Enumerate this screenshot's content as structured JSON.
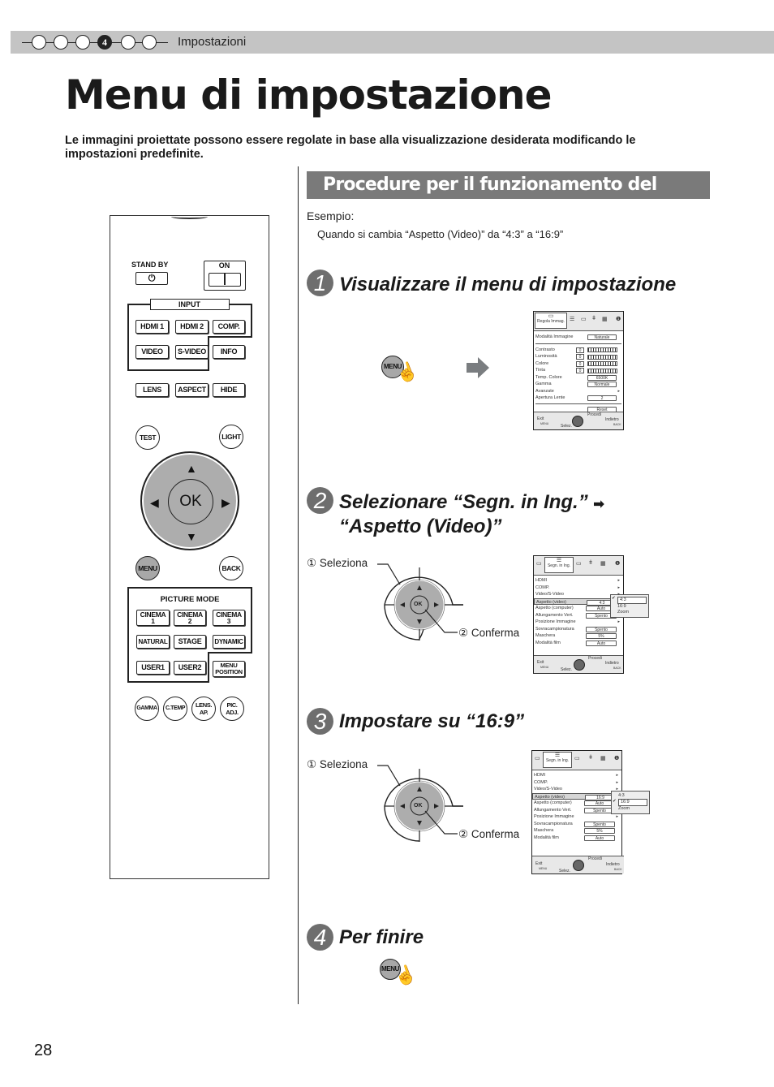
{
  "header": {
    "chapter_dots": [
      "",
      "",
      "",
      "4",
      "",
      ""
    ],
    "active_chapter": "4",
    "section": "Impostazioni"
  },
  "title": "Menu di impostazione",
  "intro": "Le immagini proiettate possono essere regolate in base alla visualizzazione desiderata modificando le impostazioni predefinite.",
  "remote": {
    "standby_label": "STAND BY",
    "on_label": "ON",
    "input_label": "INPUT",
    "input_buttons": [
      "HDMI 1",
      "HDMI 2",
      "COMP.",
      "VIDEO",
      "S-VIDEO",
      "INFO"
    ],
    "row_buttons": [
      "LENS",
      "ASPECT",
      "HIDE"
    ],
    "test": "TEST",
    "light": "LIGHT",
    "ok": "OK",
    "menu": "MENU",
    "back": "BACK",
    "picture_mode_label": "PICTURE MODE",
    "picture_mode_buttons": [
      {
        "l1": "CINEMA",
        "l2": "1"
      },
      {
        "l1": "CINEMA",
        "l2": "2"
      },
      {
        "l1": "CINEMA",
        "l2": "3"
      },
      {
        "l1": "NATURAL",
        "l2": ""
      },
      {
        "l1": "STAGE",
        "l2": ""
      },
      {
        "l1": "DYNAMIC",
        "l2": ""
      },
      {
        "l1": "USER1",
        "l2": ""
      },
      {
        "l1": "USER2",
        "l2": ""
      },
      {
        "l1": "MENU",
        "l2": "POSITION"
      }
    ],
    "bottom_buttons": [
      {
        "l1": "GAMMA",
        "l2": ""
      },
      {
        "l1": "C.TEMP",
        "l2": ""
      },
      {
        "l1": "LENS.",
        "l2": "AP."
      },
      {
        "l1": "PIC.",
        "l2": "ADJ."
      }
    ]
  },
  "main": {
    "banner": "Procedure per il funzionamento del menu",
    "example_label": "Esempio:",
    "example_text": "Quando si cambia “Aspetto (Video)” da “4:3” a “16:9”",
    "steps": [
      {
        "num": "1",
        "text": "Visualizzare il menu di impostazione"
      },
      {
        "num": "2",
        "text": "Selezionare “Segn. in Ing.”",
        "text2": "“Aspetto (Video)”"
      },
      {
        "num": "3",
        "text": "Impostare su “16:9”"
      },
      {
        "num": "4",
        "text": "Per finire"
      }
    ],
    "menu_button": "MENU",
    "dpad": {
      "select": "Seleziona",
      "confirm": "Conferma",
      "ok": "OK",
      "n1": "①",
      "n2": "②"
    }
  },
  "osd1": {
    "tab": "Regola Immag.",
    "rows": [
      {
        "label": "Modalità Immagine",
        "value": "Naturale"
      },
      {
        "label": "Contrasto",
        "num": "0"
      },
      {
        "label": "Luminosità",
        "num": "0"
      },
      {
        "label": "Colore",
        "num": "0"
      },
      {
        "label": "Tinta",
        "num": "0"
      },
      {
        "label": "Temp. Colore",
        "value": "6500K"
      },
      {
        "label": "Gamma",
        "value": "Normale"
      },
      {
        "label": "Avanzate",
        "value": ""
      },
      {
        "label": "Apertura Lente",
        "value": "2"
      },
      {
        "label": "",
        "value": "Reset"
      }
    ],
    "footer": {
      "exit": "Exit",
      "exit_key": "MENU",
      "select": "Selez.",
      "enter": "Procedi",
      "back": "Indietro",
      "back_key": "BACK"
    }
  },
  "osd2": {
    "tab": "Segn. in Ing.",
    "rows": [
      {
        "label": "HDMI",
        "value": ""
      },
      {
        "label": "COMP.",
        "value": ""
      },
      {
        "label": "Video/S-Video",
        "value": ""
      },
      {
        "label": "Aspetto (video)",
        "value": "4:3"
      },
      {
        "label": "Aspetto (computer)",
        "value": "Auto"
      },
      {
        "label": "Allungamento Vert.",
        "value": "Spento"
      },
      {
        "label": "Posizione Immagine",
        "value": ""
      },
      {
        "label": "Sovracampionatura",
        "value": "Spento"
      },
      {
        "label": "Maschera",
        "value": "5%"
      },
      {
        "label": "Modalità film",
        "value": "Auto"
      }
    ],
    "popup": [
      "4:3",
      "16:9",
      "Zoom"
    ],
    "popup_selected": "4:3",
    "footer": {
      "exit": "Exit",
      "exit_key": "MENU",
      "select": "Selez.",
      "enter": "Procedi",
      "back": "Indietro",
      "back_key": "BACK"
    }
  },
  "osd3": {
    "tab": "Segn. in Ing.",
    "rows": [
      {
        "label": "HDMI",
        "value": ""
      },
      {
        "label": "COMP.",
        "value": ""
      },
      {
        "label": "Video/S-Video",
        "value": ""
      },
      {
        "label": "Aspetto (video)",
        "value": "16:9"
      },
      {
        "label": "Aspetto (computer)",
        "value": "Auto"
      },
      {
        "label": "Allungamento Vert.",
        "value": "Spento"
      },
      {
        "label": "Posizione Immagine",
        "value": ""
      },
      {
        "label": "Sovracampionatura",
        "value": "Spento"
      },
      {
        "label": "Maschera",
        "value": "5%"
      },
      {
        "label": "Modalità film",
        "value": "Auto"
      }
    ],
    "popup": [
      "4:3",
      "16:9",
      "Zoom"
    ],
    "popup_selected": "16:9",
    "footer": {
      "exit": "Exit",
      "exit_key": "MENU",
      "select": "Selez.",
      "enter": "Procedi",
      "back": "Indietro",
      "back_key": "BACK"
    }
  },
  "page_number": "28"
}
